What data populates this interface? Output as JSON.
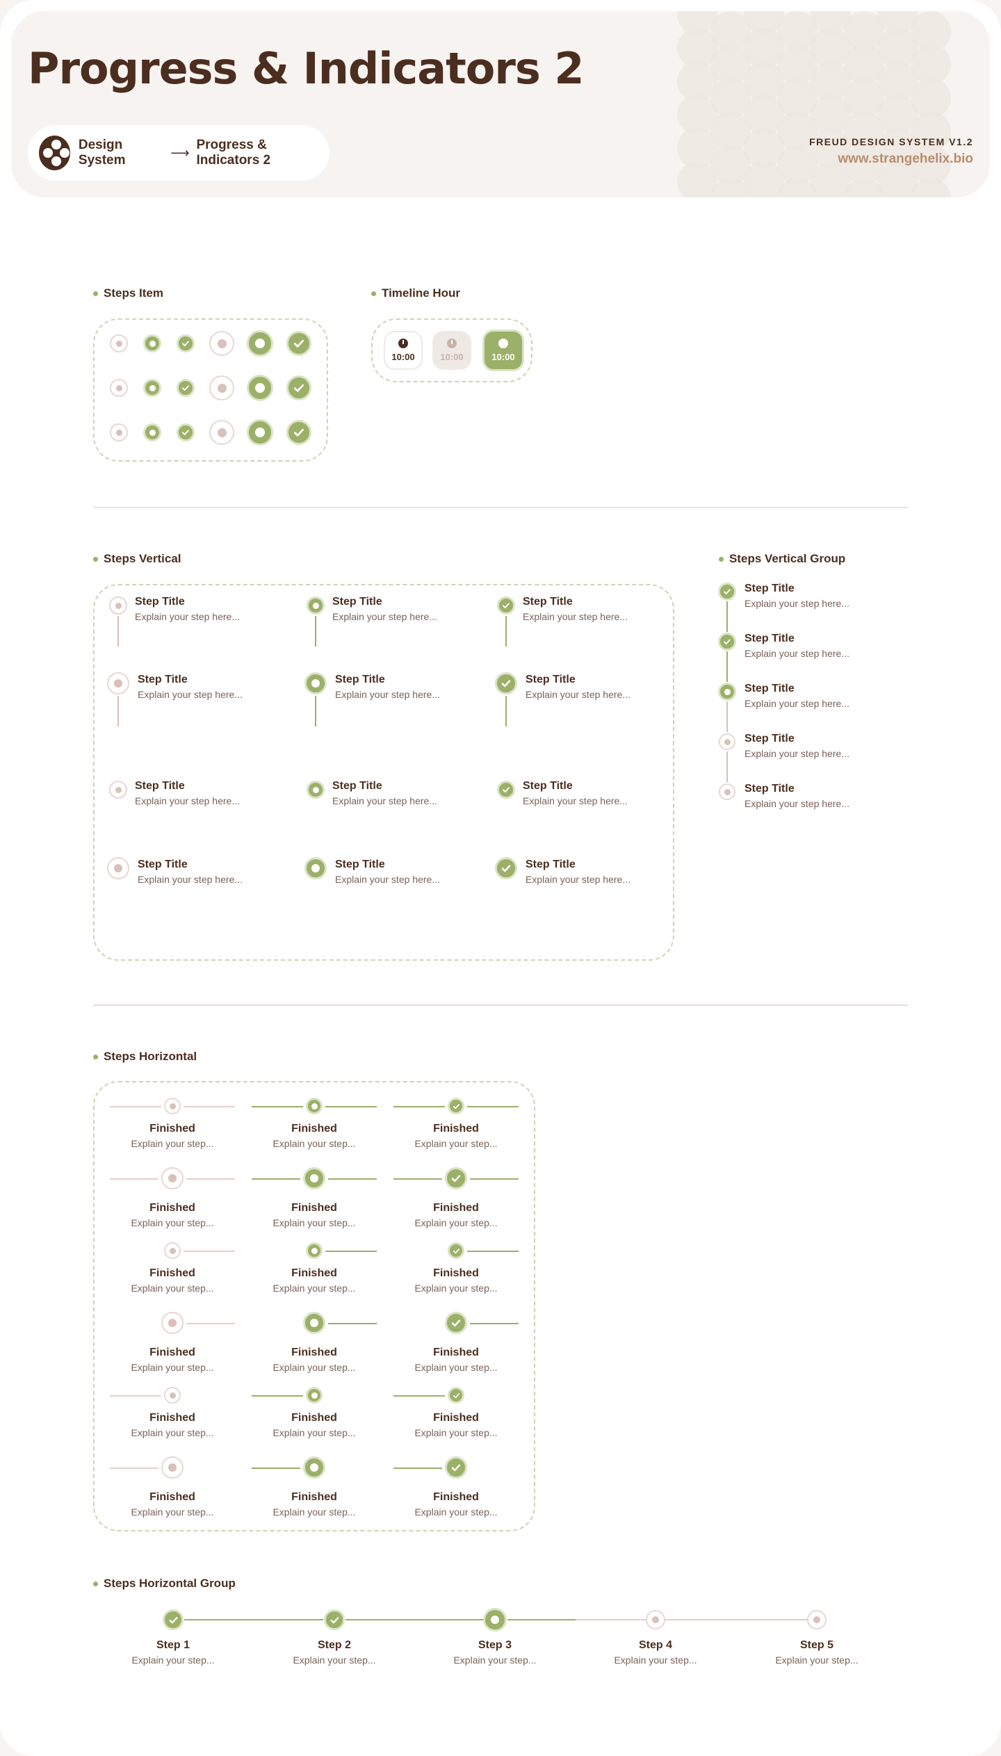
{
  "header": {
    "title": "Progress & Indicators 2",
    "breadcrumb": [
      "Design System",
      "Progress & Indicators 2"
    ],
    "version": "FREUD DESIGN SYSTEM V1.2",
    "site": "www.strangehelix.bio"
  },
  "sections": {
    "steps_item": "Steps Item",
    "timeline_hour": "Timeline Hour",
    "steps_vertical": "Steps Vertical",
    "steps_vertical_group": "Steps Vertical Group",
    "steps_horizontal": "Steps Horizontal",
    "steps_horizontal_group": "Steps Horizontal Group"
  },
  "timeline": {
    "time": "10:00"
  },
  "step": {
    "title": "Step Title",
    "desc": "Explain your step here...",
    "h_title": "Finished",
    "h_desc": "Explain your step..."
  },
  "horizontal_group": [
    "Step 1",
    "Step 2",
    "Step 3",
    "Step 4",
    "Step 5"
  ],
  "colors": {
    "accent": "#9bb068",
    "brown": "#4b2e1f",
    "muted": "#d8c1b8"
  },
  "icons": {
    "check": "check-icon",
    "clock": "clock-icon",
    "logo": "freud-logo-icon"
  }
}
